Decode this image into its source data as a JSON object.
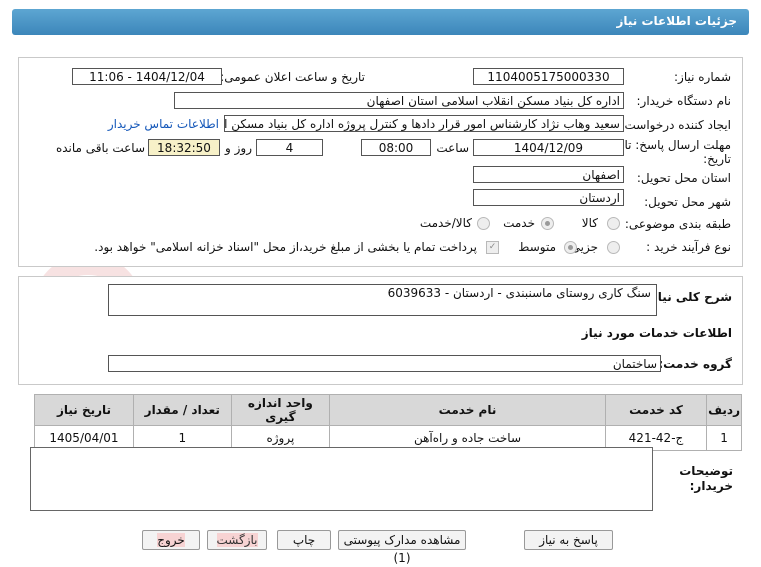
{
  "header": {
    "title": "جزئیات اطلاعات نیاز"
  },
  "form": {
    "need_number_label": "شماره نیاز:",
    "need_number": "1104005175000330",
    "announce_label": "تاریخ و ساعت اعلان عمومی:",
    "announce_value": "1404/12/04 - 11:06",
    "buyer_label": "نام دستگاه خریدار:",
    "buyer_value": "اداره کل بنیاد مسکن انقلاب اسلامی استان اصفهان",
    "requester_label": "ایجاد کننده درخواست:",
    "requester_value": "سعید وهاب نژاد کارشناس امور قرار دادها و کنترل  پروژه اداره کل بنیاد مسکن انق",
    "contact_link": "اطلاعات تماس خریدار",
    "deadline_label_1": "مهلت ارسال پاسخ: تا",
    "deadline_label_2": "تاریخ:",
    "deadline_date": "1404/12/09",
    "time_label": "ساعت",
    "deadline_time": "08:00",
    "days_value": "4",
    "days_label": "روز و",
    "remaining_time": "18:32:50",
    "remaining_label": "ساعت باقی مانده",
    "province_label": "استان محل تحویل:",
    "province_value": "اصفهان",
    "city_label": "شهر محل تحویل:",
    "city_value": "اردستان",
    "category_label": "طبقه بندی موضوعی:",
    "category_options": [
      "کالا",
      "خدمت",
      "کالا/خدمت"
    ],
    "category_selected": "خدمت",
    "process_label": "نوع فرآیند خرید :",
    "process_options": [
      "جزیی",
      "متوسط"
    ],
    "process_selected": "متوسط",
    "treasury_note": "پرداخت تمام یا بخشی از مبلغ خرید،از محل \"اسناد خزانه اسلامی\" خواهد بود."
  },
  "description": {
    "label": "شرح کلی نیاز:",
    "value": "سنگ کاری روستای ماسنبندی - اردستان - 6039633"
  },
  "services_title": "اطلاعات خدمات مورد نیاز",
  "service_group": {
    "label": "گروه خدمت:",
    "value": "ساختمان"
  },
  "table": {
    "headers": [
      "ردیف",
      "کد خدمت",
      "نام خدمت",
      "واحد اندازه گیری",
      "تعداد / مقدار",
      "تاریخ نیاز"
    ],
    "rows": [
      [
        "1",
        "ج-42-421",
        "ساخت جاده و راه‌آهن",
        "پروژه",
        "1",
        "1405/04/01"
      ]
    ]
  },
  "buyer_notes": {
    "label_1": "توضیحات",
    "label_2": "خریدار:",
    "value": ""
  },
  "buttons": {
    "reply": "پاسخ به نیاز",
    "attachments": "مشاهده مدارک پیوستی (1)",
    "print": "چاپ",
    "back": "بازگشت",
    "exit": "خروج"
  },
  "watermark": "AriaTender.net",
  "colors": {
    "header": "#3c86ba",
    "link": "#1457b9",
    "exit_button": "#f7d3d3",
    "remaining_bg": "#f7f1c8"
  }
}
